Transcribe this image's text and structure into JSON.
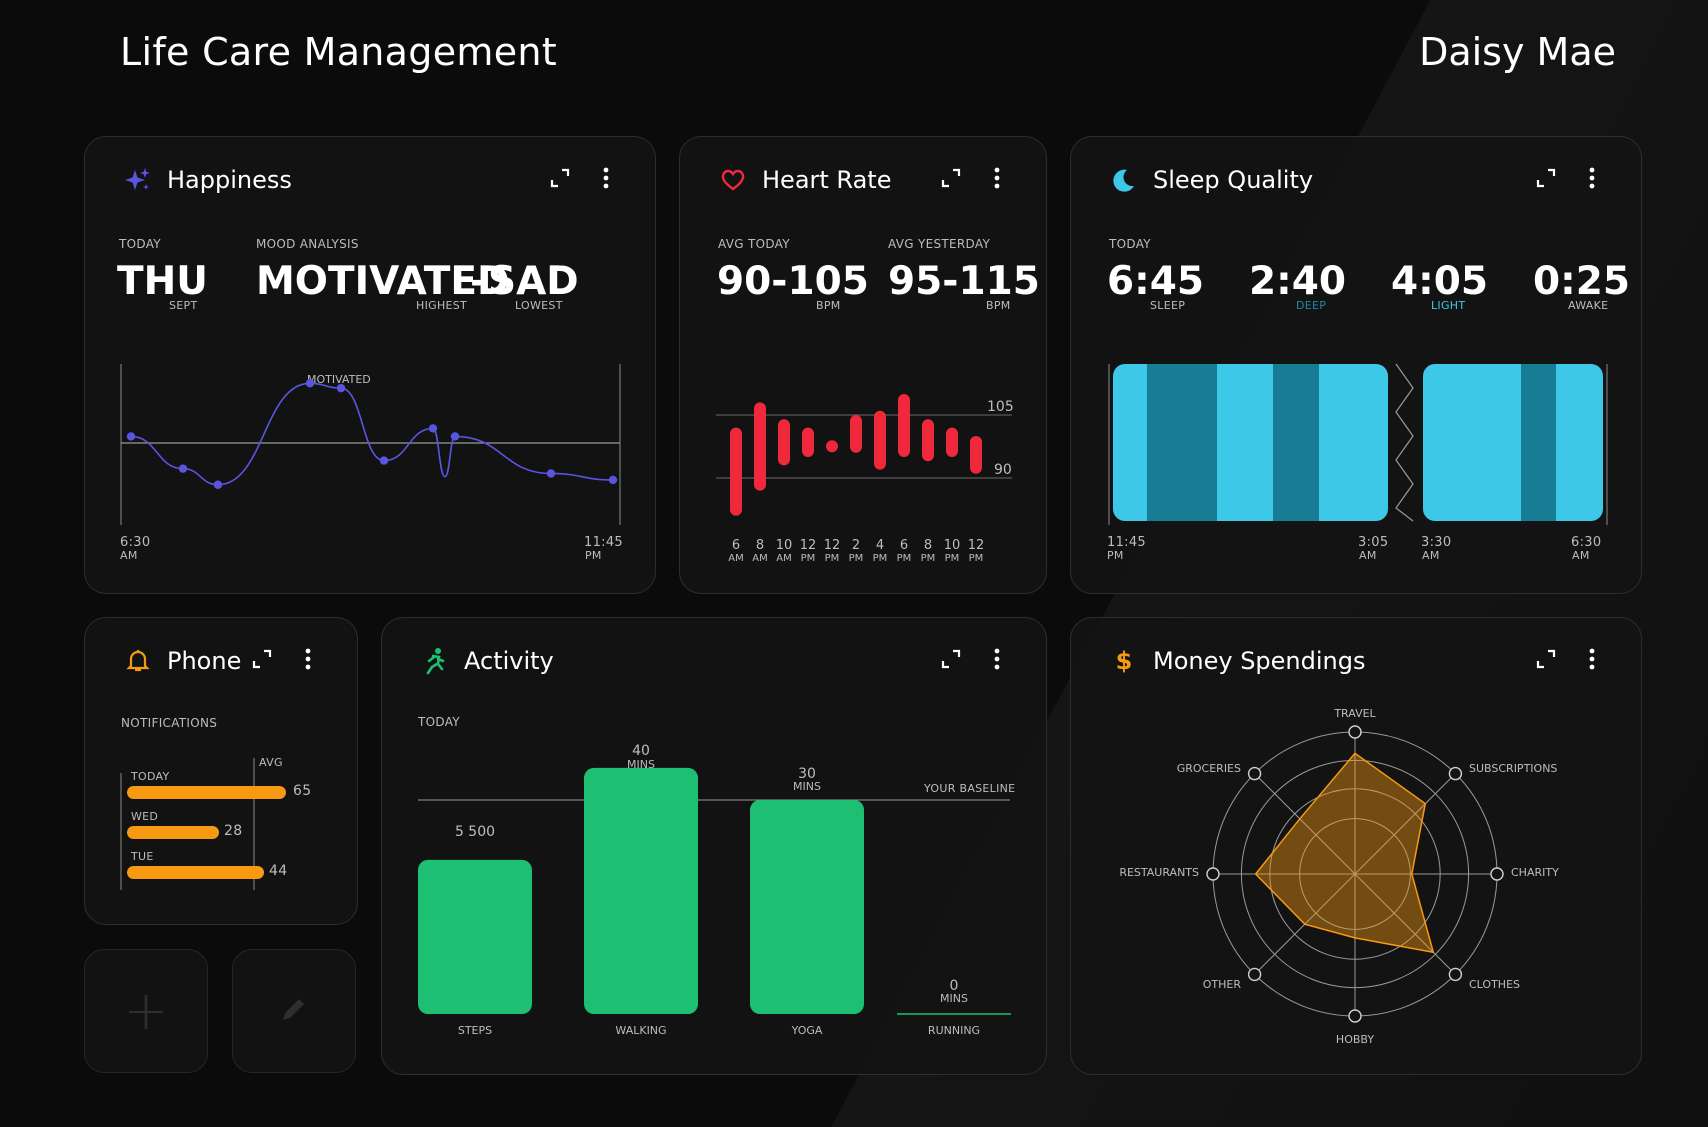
{
  "header": {
    "title": "Life Care Management",
    "user": "Daisy Mae"
  },
  "happiness": {
    "title": "Happiness",
    "today_label": "TODAY",
    "day": "THU",
    "month": "SEPT",
    "mood_label": "MOOD ANALYSIS",
    "highest": "MOTIVATED",
    "dash": "-",
    "lowest": "SAD",
    "highest_label": "HIGHEST",
    "lowest_label": "LOWEST",
    "peak_label": "MOTIVATED",
    "start_time": "6:30",
    "start_ampm": "AM",
    "end_time": "11:45",
    "end_ampm": "PM"
  },
  "heart": {
    "title": "Heart Rate",
    "avg_today_label": "AVG TODAY",
    "avg_today": "90-105",
    "avg_yesterday_label": "AVG YESTERDAY",
    "avg_yesterday": "95-115",
    "unit": "BPM",
    "line_high": "105",
    "line_low": "90"
  },
  "sleep": {
    "title": "Sleep Quality",
    "today_label": "TODAY",
    "stats": [
      {
        "value": "6:45",
        "label": "SLEEP",
        "color": "#bdbdbd"
      },
      {
        "value": "2:40",
        "label": "DEEP",
        "color": "#1a8aa6"
      },
      {
        "value": "4:05",
        "label": "LIGHT",
        "color": "#3ec8e8"
      },
      {
        "value": "0:25",
        "label": "AWAKE",
        "color": "#bdbdbd"
      }
    ],
    "times": [
      {
        "time": "11:45",
        "ampm": "PM"
      },
      {
        "time": "3:05",
        "ampm": "AM"
      },
      {
        "time": "3:30",
        "ampm": "AM"
      },
      {
        "time": "6:30",
        "ampm": "AM"
      }
    ]
  },
  "phone": {
    "title": "Phone",
    "notifications_label": "NOTIFICATIONS",
    "avg_label": "AVG",
    "rows": [
      {
        "label": "TODAY",
        "value": "65"
      },
      {
        "label": "WED",
        "value": "28"
      },
      {
        "label": "TUE",
        "value": "44"
      }
    ]
  },
  "activity": {
    "title": "Activity",
    "today_label": "TODAY",
    "baseline_label": "YOUR BASELINE",
    "bars": [
      {
        "name": "STEPS",
        "value": "5 500",
        "unit": ""
      },
      {
        "name": "WALKING",
        "value": "40",
        "unit": "MINS"
      },
      {
        "name": "YOGA",
        "value": "30",
        "unit": "MINS"
      },
      {
        "name": "RUNNING",
        "value": "0",
        "unit": "MINS"
      }
    ]
  },
  "money": {
    "title": "Money Spendings",
    "axes": [
      "TRAVEL",
      "SUBSCRIPTIONS",
      "CHARITY",
      "CLOTHES",
      "HOBBY",
      "OTHER",
      "RESTAURANTS",
      "GROCERIES"
    ]
  },
  "tiles": {
    "add": "+",
    "edit": ""
  },
  "chart_data": [
    {
      "type": "line",
      "title": "Happiness",
      "series": [
        {
          "values": [
            0.45,
            0.65,
            0.75,
            0.12,
            0.15,
            0.6,
            0.4,
            0.7,
            0.45,
            0.68,
            0.72
          ]
        }
      ]
    },
    {
      "type": "bar",
      "title": "Heart Rate",
      "categories": [
        "6 AM",
        "8 AM",
        "10 AM",
        "12 PM",
        "12 PM",
        "2 PM",
        "4 PM",
        "6 PM",
        "8 PM",
        "10 PM",
        "12 PM"
      ],
      "ylabel": "BPM",
      "reference_lines": [
        105,
        90
      ],
      "series": [
        {
          "name": "low",
          "values": [
            81,
            87,
            93,
            95,
            97,
            96,
            92,
            95,
            94,
            95,
            91
          ]
        },
        {
          "name": "high",
          "values": [
            102,
            108,
            104,
            102,
            99,
            105,
            106,
            110,
            104,
            102,
            100
          ]
        }
      ]
    },
    {
      "type": "bar",
      "title": "Activity",
      "categories": [
        "STEPS",
        "WALKING",
        "YOGA",
        "RUNNING"
      ],
      "series": [
        {
          "values": [
            0.72,
            1.15,
            1.0,
            0
          ]
        }
      ]
    },
    {
      "type": "radar",
      "title": "Money Spendings",
      "categories": [
        "TRAVEL",
        "SUBSCRIPTIONS",
        "CHARITY",
        "CLOTHES",
        "HOBBY",
        "OTHER",
        "RESTAURANTS",
        "GROCERIES"
      ],
      "series": [
        {
          "values": [
            0.85,
            0.7,
            0.4,
            0.78,
            0.45,
            0.5,
            0.7,
            0.55
          ]
        }
      ]
    }
  ]
}
